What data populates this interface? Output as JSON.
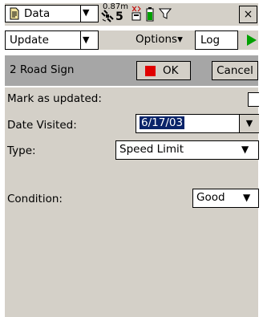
{
  "statusbar": {
    "data_label": "Data",
    "gps_distance": "0.87m",
    "satellite_count": "5",
    "close_label": "×"
  },
  "toolbar": {
    "update_label": "Update",
    "options_label": "Options▾",
    "log_label": "Log"
  },
  "header": {
    "title": "2 Road Sign",
    "ok_label": "OK",
    "cancel_label": "Cancel"
  },
  "form": {
    "mark_label": "Mark as updated:",
    "date_label": "Date Visited:",
    "date_value": "6/17/03",
    "type_label": "Type:",
    "type_value": "Speed Limit",
    "condition_label": "Condition:",
    "condition_value": "Good"
  },
  "colors": {
    "accent_play": "#00a000",
    "ok_stop": "#e00000",
    "selection": "#0a246a"
  }
}
